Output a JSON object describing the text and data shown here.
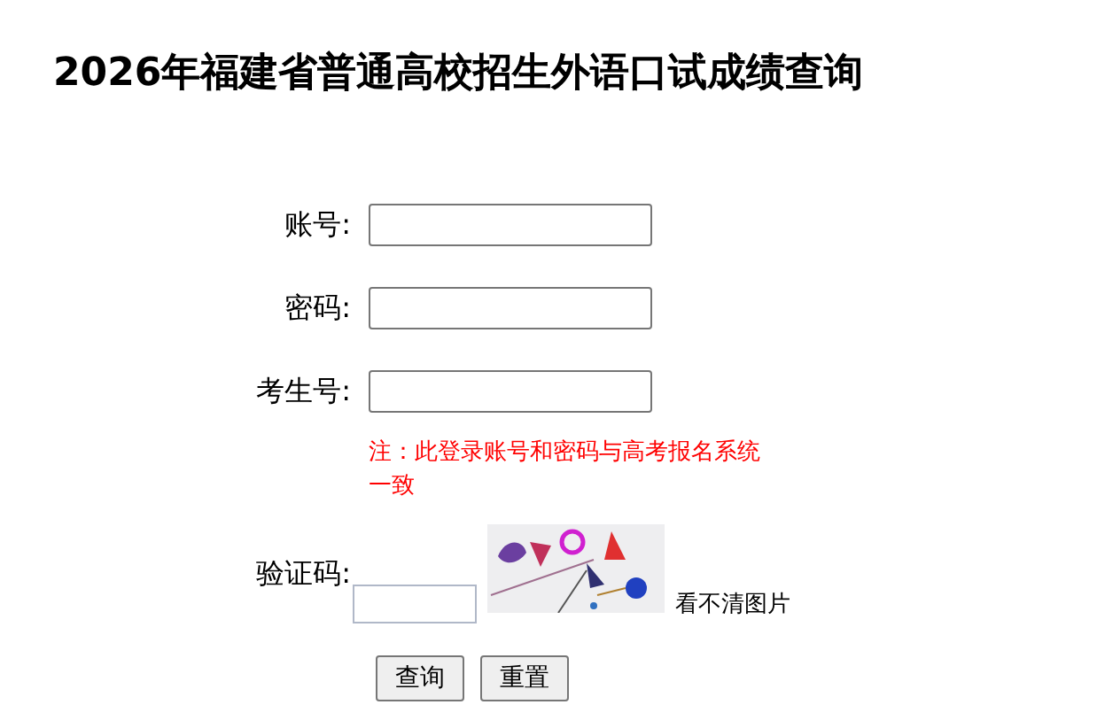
{
  "title": "2026年福建省普通高校招生外语口试成绩查询",
  "fields": [
    {
      "label": "账号:"
    },
    {
      "label": "密码:"
    },
    {
      "label": "考生号:"
    }
  ],
  "note": "注：此登录账号和密码与高考报名系统一致",
  "captcha": {
    "label": "验证码:",
    "refresh_link": "看不清图片"
  },
  "buttons": [
    "查询",
    "重置"
  ]
}
